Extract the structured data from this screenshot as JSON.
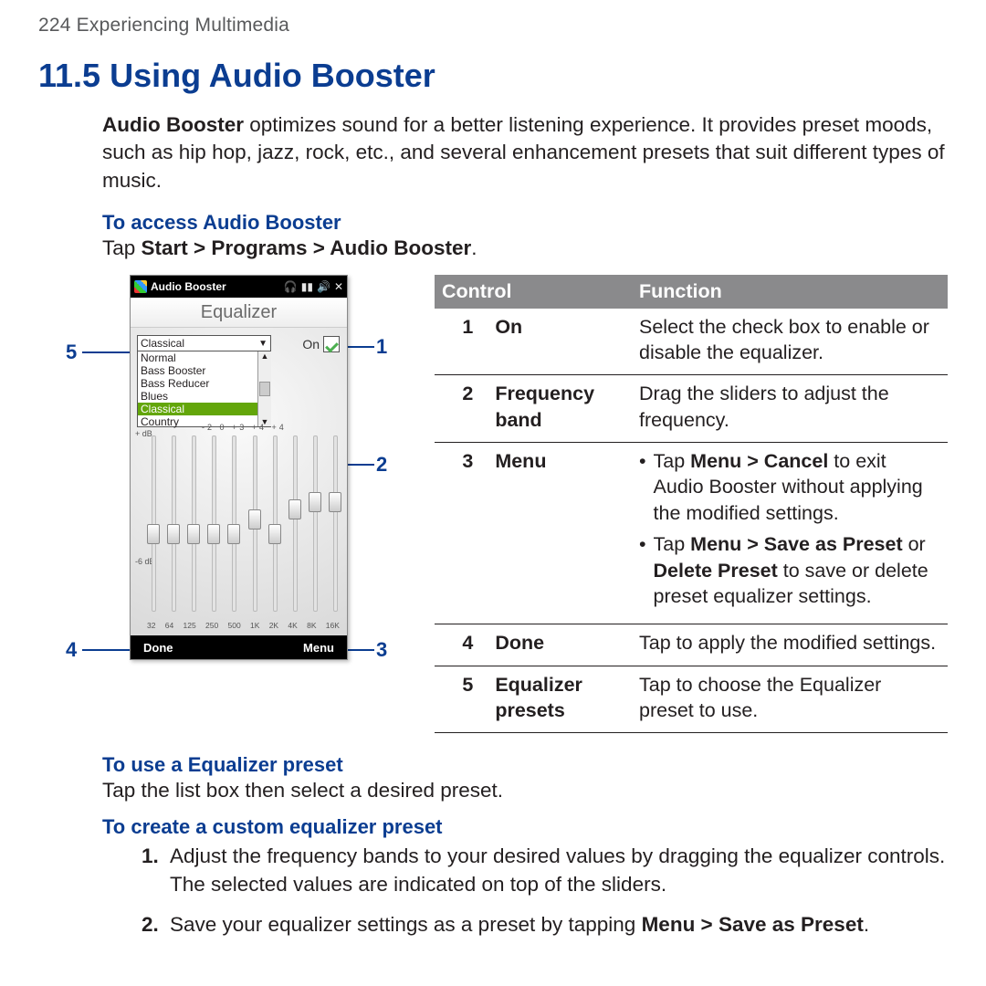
{
  "page_header": "224  Experiencing Multimedia",
  "section_title": "11.5  Using Audio Booster",
  "intro_bold": "Audio Booster",
  "intro_rest": " optimizes sound for a better listening experience. It provides preset moods, such as hip hop, jazz, rock, etc., and several enhancement presets that suit different types of music.",
  "heads": {
    "access": "To access Audio Booster",
    "use_preset": "To use a Equalizer preset",
    "create_preset": "To create a custom equalizer preset"
  },
  "access_line_pre": "Tap ",
  "access_line_bold": "Start > Programs > Audio Booster",
  "access_line_post": ".",
  "use_preset_line": "Tap the list box then select a desired preset.",
  "steps": {
    "s1": "Adjust the frequency bands to your desired values by dragging the equalizer controls. The selected values are indicated on top of the sliders.",
    "s2_pre": "Save your equalizer settings as a preset by tapping ",
    "s2_bold": "Menu > Save as Preset",
    "s2_post": "."
  },
  "callouts": {
    "c1": "1",
    "c2": "2",
    "c3": "3",
    "c4": "4",
    "c5": "5"
  },
  "phone": {
    "app_title": "Audio Booster",
    "screen_title": "Equalizer",
    "on_label": "On",
    "done": "Done",
    "menu": "Menu",
    "close": "✕",
    "preset_selected": "Classical",
    "presets": [
      "Normal",
      "Bass Booster",
      "Bass Reducer",
      "Blues",
      "Classical",
      "Country"
    ],
    "db_plus": "+\ndB",
    "db_minus": "-6\ndB",
    "top_vals": "-2   0   +3   +4   +4",
    "freqs": [
      "32",
      "64",
      "125",
      "250",
      "500",
      "1K",
      "2K",
      "4K",
      "8K",
      "16K"
    ],
    "knobs_pct": [
      50,
      50,
      50,
      50,
      50,
      42,
      50,
      36,
      32,
      32
    ]
  },
  "table": {
    "head_control": "Control",
    "head_function": "Function",
    "r1": {
      "n": "1",
      "name": "On",
      "fn": "Select the check box to enable or disable the equalizer."
    },
    "r2": {
      "n": "2",
      "name": "Frequency band",
      "fn": "Drag the sliders to adjust the frequency."
    },
    "r3": {
      "n": "3",
      "name": "Menu",
      "b1_pre": "Tap ",
      "b1_bold": "Menu > Cancel",
      "b1_post": " to exit Audio Booster without applying the modified settings.",
      "b2_pre": "Tap ",
      "b2_bold1": "Menu > Save as Preset",
      "b2_mid": " or ",
      "b2_bold2": "Delete Preset",
      "b2_post": " to save or delete preset equalizer settings."
    },
    "r4": {
      "n": "4",
      "name": "Done",
      "fn": "Tap to apply the modified settings."
    },
    "r5": {
      "n": "5",
      "name": "Equalizer presets",
      "fn": "Tap to choose the Equalizer preset to use."
    }
  }
}
